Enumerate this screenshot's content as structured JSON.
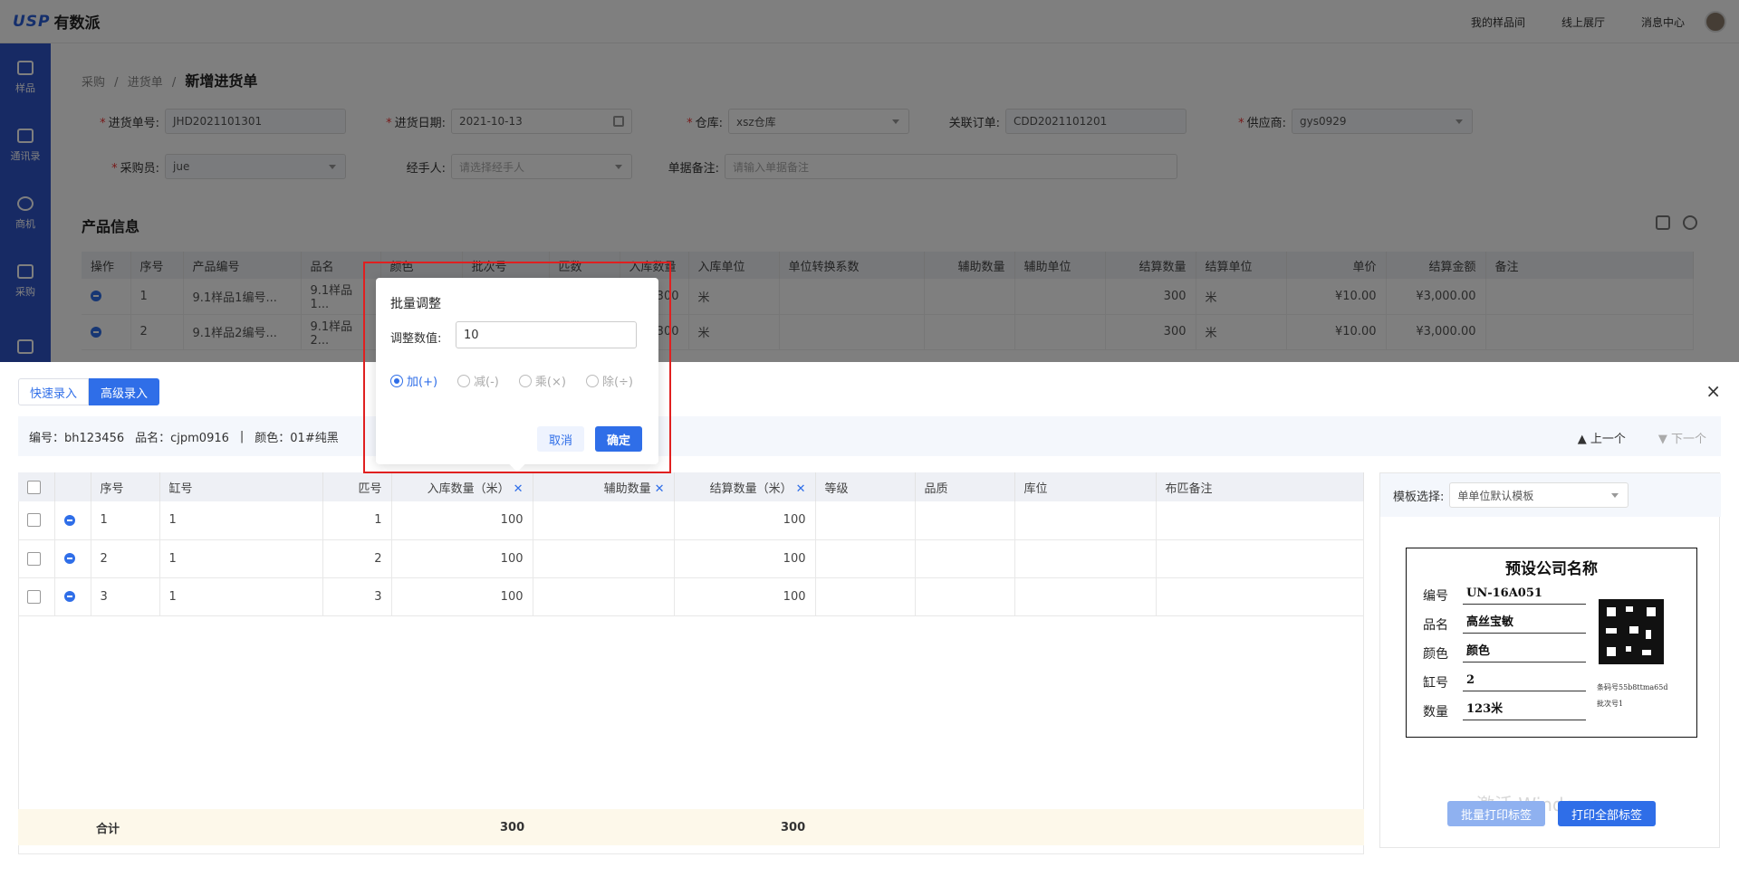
{
  "app": {
    "logo_mark": "USP",
    "logo_name": "有数派"
  },
  "topnav": [
    "我的样品间",
    "线上展厅",
    "消息中心"
  ],
  "sidebar": [
    "样品",
    "通讯录",
    "商机",
    "采购",
    ""
  ],
  "breadcrumb": {
    "a": "采购",
    "sep": "/",
    "b": "进货单",
    "current": "新增进货单"
  },
  "form": {
    "order_no_label": "进货单号:",
    "order_no": "JHD2021101301",
    "date_label": "进货日期:",
    "date": "2021-10-13",
    "warehouse_label": "仓库:",
    "warehouse": "xsz仓库",
    "linked_order_label": "关联订单:",
    "linked_order": "CDD2021101201",
    "supplier_label": "供应商:",
    "supplier": "gys0929",
    "buyer_label": "采购员:",
    "buyer": "jue",
    "handler_label": "经手人:",
    "handler_placeholder": "请选择经手人",
    "remark_label": "单据备注:",
    "remark_placeholder": "请输入单据备注"
  },
  "product_section": {
    "title": "产品信息",
    "headers": [
      "操作",
      "序号",
      "产品编号",
      "品名",
      "颜色",
      "批次号",
      "匹数",
      "入库数量",
      "入库单位",
      "单位转换系数",
      "辅助数量",
      "辅助单位",
      "结算数量",
      "结算单位",
      "单价",
      "结算金额",
      "备注"
    ],
    "rows": [
      {
        "no": "1",
        "code": "9.1样品1编号...",
        "name": "9.1样品1...",
        "qty": "300",
        "unit": "米",
        "settle_qty": "300",
        "settle_unit": "米",
        "price": "¥10.00",
        "amount": "¥3,000.00"
      },
      {
        "no": "2",
        "code": "9.1样品2编号...",
        "name": "9.1样品2...",
        "qty": "300",
        "unit": "米",
        "settle_qty": "300",
        "settle_unit": "米",
        "price": "¥10.00",
        "amount": "¥3,000.00"
      }
    ]
  },
  "drawer": {
    "tab_quick": "快速录入",
    "tab_advanced": "高级录入",
    "close": "×",
    "info": {
      "code": "编号：bh123456",
      "name": "品名：cjpm0916",
      "sep": "|",
      "color": "颜色：01#纯黑"
    },
    "prev": "▲ 上一个",
    "next": "▼ 下一个",
    "headers": {
      "seq": "序号",
      "vat": "缸号",
      "bolt": "匹号",
      "in_qty": "入库数量（米）",
      "aux_qty": "辅助数量",
      "settle_qty": "结算数量（米）",
      "grade": "等级",
      "quality": "品质",
      "location": "库位",
      "remark": "布匹备注"
    },
    "rows": [
      {
        "seq": "1",
        "vat": "1",
        "bolt": "1",
        "in_qty": "100",
        "settle_qty": "100"
      },
      {
        "seq": "2",
        "vat": "1",
        "bolt": "2",
        "in_qty": "100",
        "settle_qty": "100"
      },
      {
        "seq": "3",
        "vat": "1",
        "bolt": "3",
        "in_qty": "100",
        "settle_qty": "100"
      }
    ],
    "sum_label": "合计",
    "sum_in_qty": "300",
    "sum_settle_qty": "300"
  },
  "template_panel": {
    "label": "模板选择:",
    "selected": "单单位默认模板",
    "card": {
      "company": "预设公司名称",
      "fields": [
        {
          "k": "编号",
          "v": "UN-16A051"
        },
        {
          "k": "品名",
          "v": "高丝宝敏"
        },
        {
          "k": "颜色",
          "v": "颜色"
        },
        {
          "k": "缸号",
          "v": "2"
        },
        {
          "k": "数量",
          "v": "123米"
        }
      ],
      "barcode": "条码号55b8ttma65d",
      "batch": "批次号1"
    },
    "btn_batch_print": "批量打印标签",
    "btn_print_all": "打印全部标签",
    "watermark": "激活 Windows"
  },
  "popup": {
    "title": "批量调整",
    "value_label": "调整数值:",
    "value": "10",
    "ops": [
      "加(+)",
      "减(-)",
      "乘(×)",
      "除(÷)"
    ],
    "cancel": "取消",
    "ok": "确定"
  }
}
